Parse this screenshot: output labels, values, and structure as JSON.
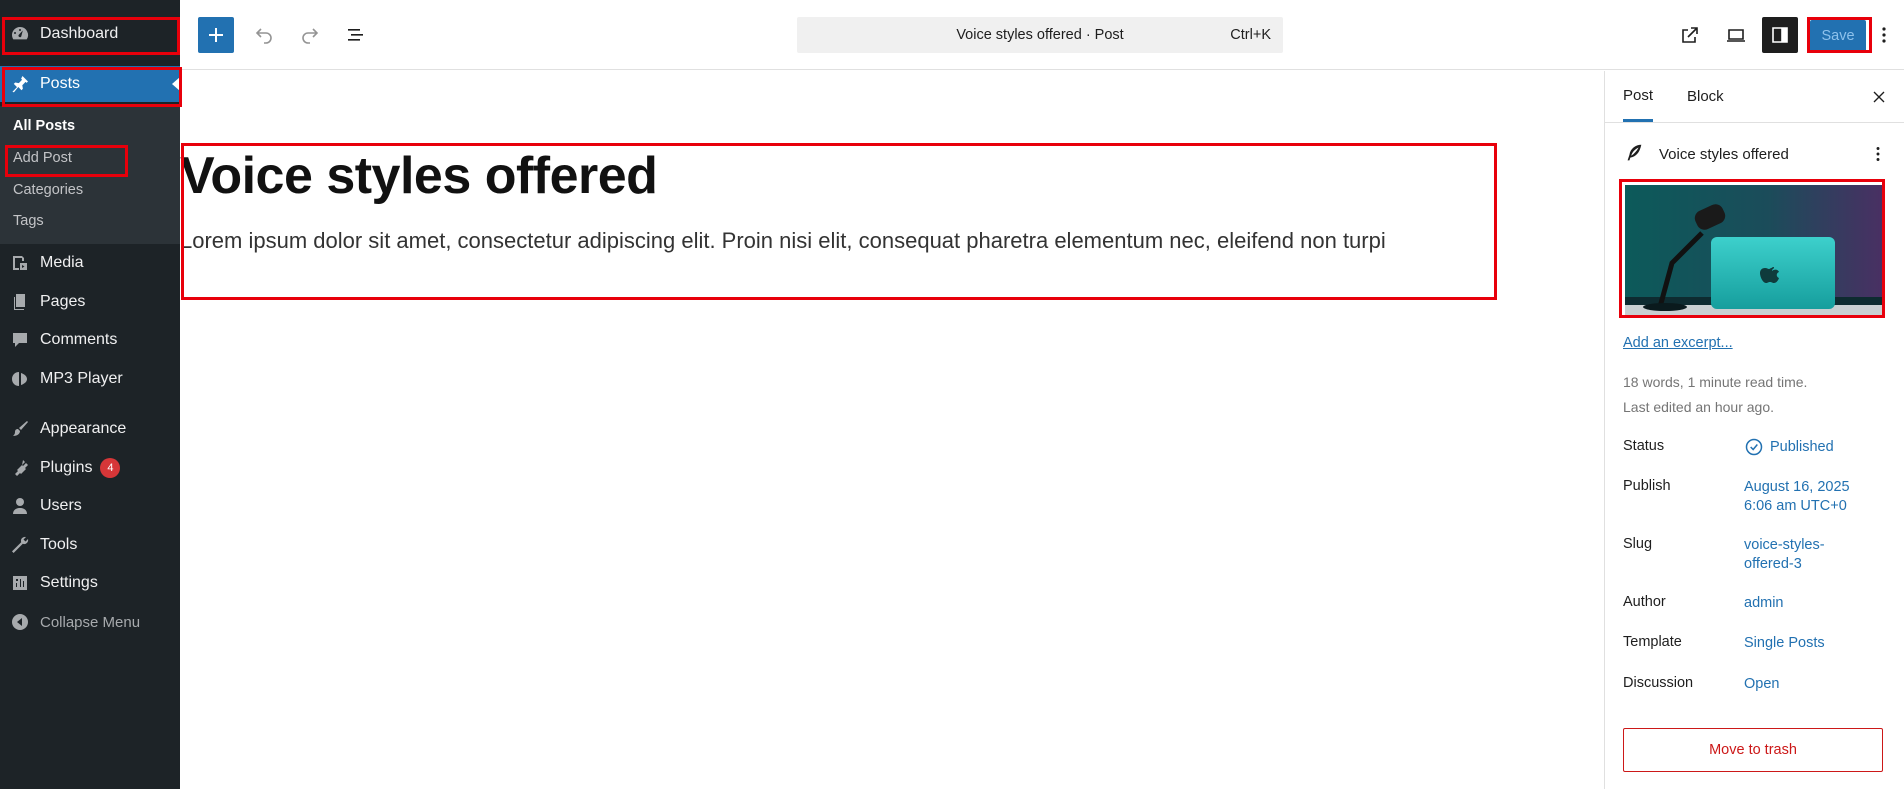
{
  "sidebar": {
    "dashboard": "Dashboard",
    "posts": "Posts",
    "submenu": {
      "all_posts": "All Posts",
      "add_post": "Add Post",
      "categories": "Categories",
      "tags": "Tags"
    },
    "media": "Media",
    "pages": "Pages",
    "comments": "Comments",
    "mp3_player": "MP3 Player",
    "appearance": "Appearance",
    "plugins": "Plugins",
    "plugins_badge": "4",
    "users": "Users",
    "tools": "Tools",
    "settings": "Settings",
    "collapse": "Collapse Menu"
  },
  "toolbar": {
    "command_title": "Voice styles offered · Post",
    "command_shortcut": "Ctrl+K",
    "save_label": "Save"
  },
  "post": {
    "title": "Voice styles offered",
    "body": "Lorem ipsum dolor sit amet, consectetur adipiscing elit. Proin nisi elit, consequat pharetra elementum nec, eleifend non turpi"
  },
  "panel": {
    "tab_post": "Post",
    "tab_block": "Block",
    "summary_title": "Voice styles offered",
    "excerpt_link": "Add an excerpt...",
    "word_count": "18 words, 1 minute read time.",
    "last_edited": "Last edited an hour ago.",
    "status_label": "Status",
    "status_value": "Published",
    "publish_label": "Publish",
    "publish_value_line1": "August 16, 2025",
    "publish_value_line2": "6:06 am UTC+0",
    "slug_label": "Slug",
    "slug_value_line1": "voice-styles-",
    "slug_value_line2": "offered-3",
    "author_label": "Author",
    "author_value": "admin",
    "template_label": "Template",
    "template_value": "Single Posts",
    "discussion_label": "Discussion",
    "discussion_value": "Open",
    "trash_label": "Move to trash"
  },
  "colors": {
    "accent": "#2271b1",
    "sidebar_bg": "#1d2327",
    "highlight": "#e8000b",
    "danger": "#cc1818"
  }
}
